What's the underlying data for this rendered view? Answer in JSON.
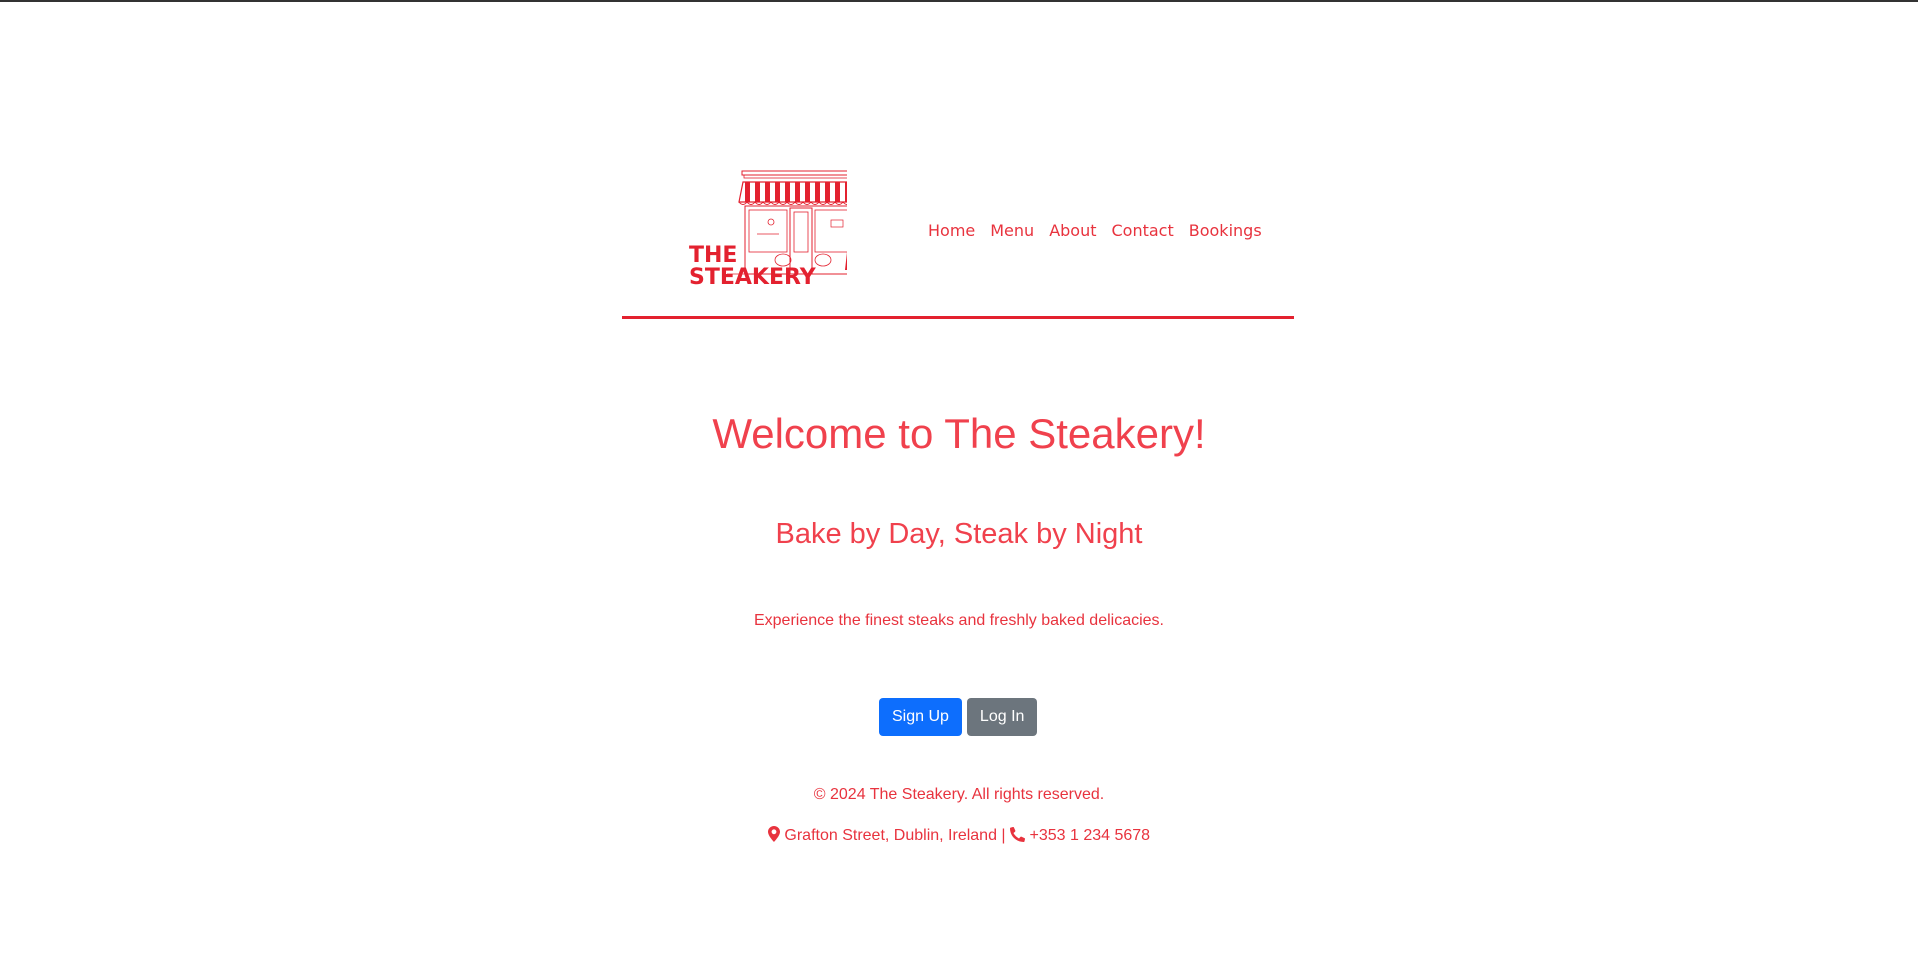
{
  "brand": {
    "name_line1": "THE",
    "name_line2": "STEAKERY",
    "logo_icon": "storefront-icon",
    "accent_color": "#e3212f"
  },
  "nav": {
    "items": [
      "Home",
      "Menu",
      "About",
      "Contact",
      "Bookings"
    ]
  },
  "hero": {
    "title": "Welcome to The Steakery!",
    "tagline": "Bake by Day, Steak by Night",
    "intro": "Experience the finest steaks and freshly baked delicacies."
  },
  "actions": {
    "signup_label": "Sign Up",
    "login_label": "Log In",
    "signup_color": "#0d6efd",
    "login_color": "#6c757d"
  },
  "footer": {
    "copyright": "© 2024 The Steakery. All rights reserved.",
    "address": "Grafton Street, Dublin, Ireland",
    "separator": "|",
    "phone": "+353 1 234 5678",
    "address_icon": "map-pin-icon",
    "phone_icon": "phone-icon"
  }
}
